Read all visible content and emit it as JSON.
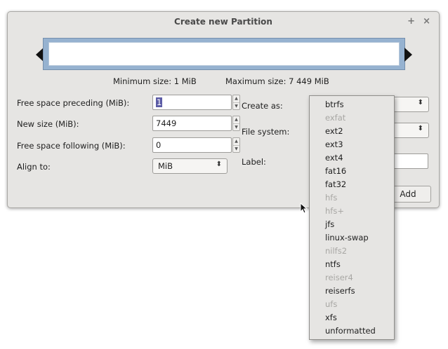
{
  "window": {
    "title": "Create new Partition",
    "pin_glyph": "+",
    "close_glyph": "×"
  },
  "sizes": {
    "minimum": "Minimum size: 1 MiB",
    "maximum": "Maximum size: 7 449 MiB"
  },
  "form": {
    "free_preceding": {
      "label": "Free space preceding (MiB):",
      "value": "1"
    },
    "new_size": {
      "label": "New size (MiB):",
      "value": "7449"
    },
    "free_following": {
      "label": "Free space following (MiB):",
      "value": "0"
    },
    "align": {
      "label": "Align to:",
      "value": "MiB"
    },
    "create_as": {
      "label": "Create as:"
    },
    "file_system": {
      "label": "File system:"
    },
    "label_field": {
      "label": "Label:",
      "value": ""
    },
    "add_button": "Add"
  },
  "dropdown": {
    "items": [
      {
        "label": "btrfs",
        "enabled": true
      },
      {
        "label": "exfat",
        "enabled": false
      },
      {
        "label": "ext2",
        "enabled": true
      },
      {
        "label": "ext3",
        "enabled": true
      },
      {
        "label": "ext4",
        "enabled": true
      },
      {
        "label": "fat16",
        "enabled": true
      },
      {
        "label": "fat32",
        "enabled": true
      },
      {
        "label": "hfs",
        "enabled": false
      },
      {
        "label": "hfs+",
        "enabled": false
      },
      {
        "label": "jfs",
        "enabled": true
      },
      {
        "label": "linux-swap",
        "enabled": true
      },
      {
        "label": "nilfs2",
        "enabled": false
      },
      {
        "label": "ntfs",
        "enabled": true
      },
      {
        "label": "reiser4",
        "enabled": false
      },
      {
        "label": "reiserfs",
        "enabled": true
      },
      {
        "label": "ufs",
        "enabled": false
      },
      {
        "label": "xfs",
        "enabled": true
      },
      {
        "label": "unformatted",
        "enabled": true
      }
    ]
  },
  "colors": {
    "partition_bar": "#96b2d0",
    "dialog_bg": "#e6e5e3",
    "selection": "#5d5da6",
    "disabled_text": "#a8a7a4"
  },
  "icons": {
    "pin": "pin-icon",
    "close": "close-icon",
    "arrow_left": "left-arrow-icon",
    "arrow_right": "right-arrow-icon",
    "cursor": "mouse-pointer-icon"
  }
}
